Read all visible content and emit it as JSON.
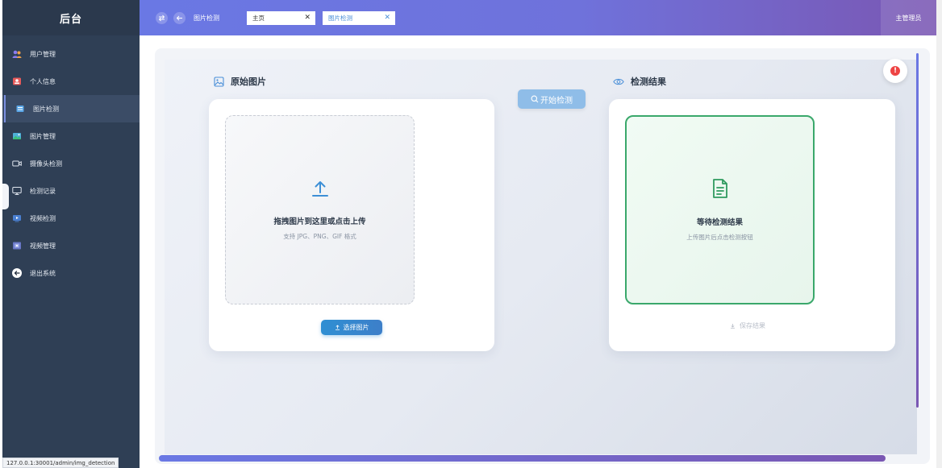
{
  "sidebar": {
    "title": "后台",
    "items": [
      {
        "label": "用户管理",
        "icon": "users-icon"
      },
      {
        "label": "个人信息",
        "icon": "id-card-icon"
      },
      {
        "label": "图片检测",
        "icon": "list-icon",
        "active": true
      },
      {
        "label": "图片管理",
        "icon": "image-icon"
      },
      {
        "label": "摄像头检测",
        "icon": "camera-icon"
      },
      {
        "label": "检测记录",
        "icon": "monitor-icon"
      },
      {
        "label": "视频检测",
        "icon": "video-icon"
      },
      {
        "label": "视频管理",
        "icon": "video-manage-icon"
      },
      {
        "label": "退出系统",
        "icon": "logout-icon"
      }
    ]
  },
  "header": {
    "title": "图片检测",
    "tabs": [
      {
        "label": "主页",
        "active": false
      },
      {
        "label": "图片检测",
        "active": true
      }
    ],
    "user": "主管理员"
  },
  "main": {
    "original_title": "原始图片",
    "result_title": "检测结果",
    "detect_button": "开始检测",
    "upload": {
      "main_text": "拖拽图片到这里或点击上传",
      "sub_text": "支持 JPG、PNG、GIF 格式",
      "select_button": "选择图片"
    },
    "result": {
      "main_text": "等待检测结果",
      "sub_text": "上传图片后点击检测按钮",
      "save_button": "保存结果"
    }
  },
  "status_bar": {
    "url": "127.0.0.1:30001/admin/img_detection"
  },
  "colors": {
    "sidebar_bg": "#2f3f55",
    "header_start": "#6a78e4",
    "header_end": "#7a57b3",
    "primary_blue": "#2f8fd3",
    "success_green": "#3aa86b",
    "alert_red": "#ee4444"
  }
}
